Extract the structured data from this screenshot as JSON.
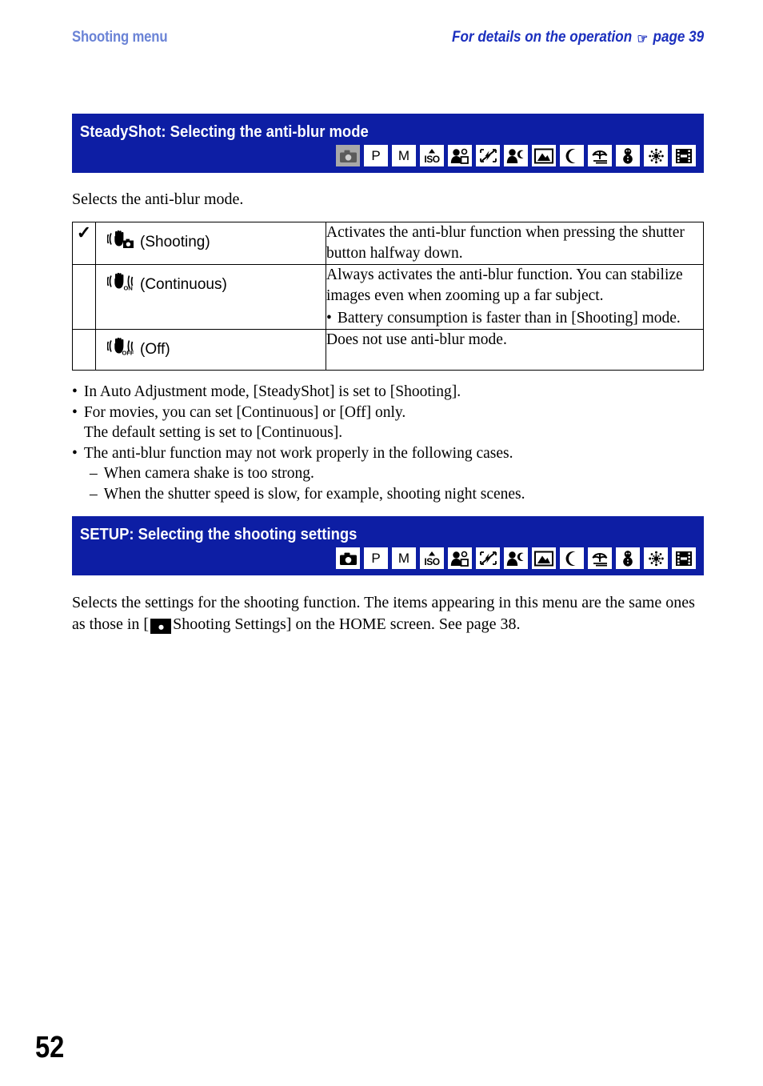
{
  "running_head": {
    "left": "Shooting menu",
    "right_text": "For details on the operation",
    "hand_icon": "☞",
    "page_ref": "page 39"
  },
  "colors": {
    "header_bar_blue": "#0d1ea4",
    "running_head_left_blue": "#6a83d6",
    "running_head_right_blue": "#1b2fbe",
    "inactive_icon_gray": "#a8a8a8"
  },
  "sections": [
    {
      "id": "steadyshot",
      "title": "SteadyShot: Selecting the anti-blur mode",
      "intro": "Selects the anti-blur mode.",
      "mode_icons": [
        {
          "name": "auto-adjustment-camera-icon",
          "glyph": "camera",
          "state": "inactive"
        },
        {
          "name": "program-auto-mode-icon",
          "glyph": "P",
          "state": "active"
        },
        {
          "name": "manual-exposure-mode-icon",
          "glyph": "M",
          "state": "active"
        },
        {
          "name": "high-sensitivity-iso-mode-icon",
          "glyph": "ISO",
          "state": "active"
        },
        {
          "name": "soft-snap-mode-icon",
          "glyph": "soft-snap",
          "state": "active"
        },
        {
          "name": "no-flash-mode-icon",
          "glyph": "no-flash",
          "state": "active"
        },
        {
          "name": "twilight-portrait-mode-icon",
          "glyph": "twilight-portrait",
          "state": "active"
        },
        {
          "name": "landscape-mode-icon",
          "glyph": "landscape",
          "state": "active"
        },
        {
          "name": "twilight-mode-icon",
          "glyph": "moon",
          "state": "active"
        },
        {
          "name": "beach-mode-icon",
          "glyph": "beach",
          "state": "active"
        },
        {
          "name": "snow-mode-icon",
          "glyph": "snowman",
          "state": "active"
        },
        {
          "name": "fireworks-mode-icon",
          "glyph": "fireworks",
          "state": "active"
        },
        {
          "name": "movie-mode-icon",
          "glyph": "film",
          "state": "active"
        }
      ],
      "options": [
        {
          "checked": true,
          "check_glyph": "✓",
          "icon": "hand-shake-shooting-icon",
          "icon_badge": "camera",
          "label": "(Shooting)",
          "description": "Activates the anti-blur function when pressing the shutter button halfway down.",
          "sub_bullets": []
        },
        {
          "checked": false,
          "check_glyph": "",
          "icon": "hand-shake-continuous-icon",
          "icon_badge": "ON",
          "label": "(Continuous)",
          "description": "Always activates the anti-blur function. You can stabilize images even when zooming up a far subject.",
          "sub_bullets": [
            "Battery consumption is faster than in [Shooting] mode."
          ]
        },
        {
          "checked": false,
          "check_glyph": "",
          "icon": "hand-shake-off-icon",
          "icon_badge": "OFF",
          "label": "(Off)",
          "description": "Does not use anti-blur mode.",
          "sub_bullets": []
        }
      ],
      "notes": [
        {
          "bullet": "•",
          "text": "In Auto Adjustment mode, [SteadyShot] is set to [Shooting].",
          "children": []
        },
        {
          "bullet": "•",
          "text": "For movies, you can set [Continuous] or [Off] only.",
          "text2": "The default setting is set to [Continuous].",
          "children": []
        },
        {
          "bullet": "•",
          "text": "The anti-blur function may not work properly in the following cases.",
          "children": [
            {
              "dash": "–",
              "text": "When camera shake is too strong."
            },
            {
              "dash": "–",
              "text": "When the shutter speed is slow, for example, shooting night scenes."
            }
          ]
        }
      ]
    },
    {
      "id": "setup",
      "title": "SETUP: Selecting the shooting settings",
      "body_part1": "Selects the settings for the shooting function. The items appearing in this menu are the same ones as those in [",
      "body_part2": "Shooting Settings] on the HOME screen. See page 38.",
      "inline_icon": "camera-icon",
      "mode_icons": [
        {
          "name": "auto-adjustment-camera-icon",
          "glyph": "camera",
          "state": "active"
        },
        {
          "name": "program-auto-mode-icon",
          "glyph": "P",
          "state": "active"
        },
        {
          "name": "manual-exposure-mode-icon",
          "glyph": "M",
          "state": "active"
        },
        {
          "name": "high-sensitivity-iso-mode-icon",
          "glyph": "ISO",
          "state": "active"
        },
        {
          "name": "soft-snap-mode-icon",
          "glyph": "soft-snap",
          "state": "active"
        },
        {
          "name": "no-flash-mode-icon",
          "glyph": "no-flash",
          "state": "active"
        },
        {
          "name": "twilight-portrait-mode-icon",
          "glyph": "twilight-portrait",
          "state": "active"
        },
        {
          "name": "landscape-mode-icon",
          "glyph": "landscape",
          "state": "active"
        },
        {
          "name": "twilight-mode-icon",
          "glyph": "moon",
          "state": "active"
        },
        {
          "name": "beach-mode-icon",
          "glyph": "beach",
          "state": "active"
        },
        {
          "name": "snow-mode-icon",
          "glyph": "snowman",
          "state": "active"
        },
        {
          "name": "fireworks-mode-icon",
          "glyph": "fireworks",
          "state": "active"
        },
        {
          "name": "movie-mode-icon",
          "glyph": "film",
          "state": "active"
        }
      ]
    }
  ],
  "page_number": "52"
}
